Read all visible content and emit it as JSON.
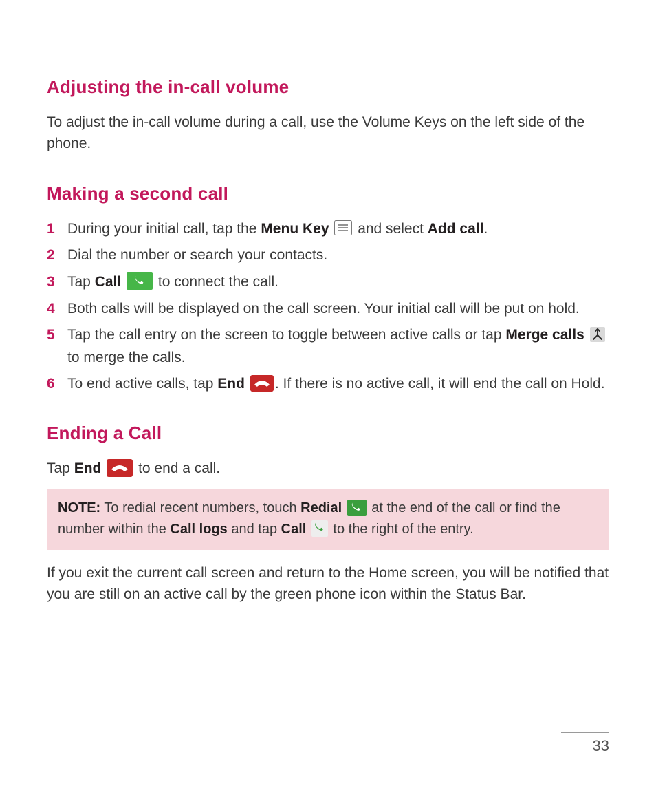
{
  "section1": {
    "heading": "Adjusting the in-call volume",
    "body": "To adjust the in-call volume during a call, use the Volume Keys on the left side of the phone."
  },
  "section2": {
    "heading": "Making a second call",
    "steps": {
      "s1_a": "During your initial call, tap the ",
      "s1_b": "Menu Key",
      "s1_c": " and select ",
      "s1_d": "Add call",
      "s1_e": ".",
      "s2": "Dial the number or search your contacts.",
      "s3_a": "Tap ",
      "s3_b": "Call",
      "s3_c": " to connect the call.",
      "s4": "Both calls will be displayed on the call screen. Your initial call will be put on hold.",
      "s5_a": "Tap the call entry on the screen to toggle between active calls or tap ",
      "s5_b": "Merge calls",
      "s5_c": " to merge the calls.",
      "s6_a": "To end active calls, tap ",
      "s6_b": "End",
      "s6_c": ". If there is no active call, it will end the call on Hold."
    }
  },
  "section3": {
    "heading": "Ending a Call",
    "p1_a": "Tap ",
    "p1_b": "End",
    "p1_c": " to end a call.",
    "note": {
      "label": "NOTE:",
      "t1": " To redial recent numbers, touch ",
      "t2": "Redial",
      "t3": " at the end of the call or find the number within the ",
      "t4": "Call logs",
      "t5": " and tap ",
      "t6": "Call",
      "t7": " to the right of the entry."
    },
    "p2": "If you exit the current call screen and return to the Home screen, you will be notified that you are still on an active call by the green phone icon within the Status Bar."
  },
  "page_number": "33",
  "icons": {
    "menu": "menu-key-icon",
    "call_green": "call-green-icon",
    "merge": "merge-calls-icon",
    "end_red": "end-call-icon",
    "redial_green": "redial-icon",
    "call_small_green": "call-small-icon"
  }
}
